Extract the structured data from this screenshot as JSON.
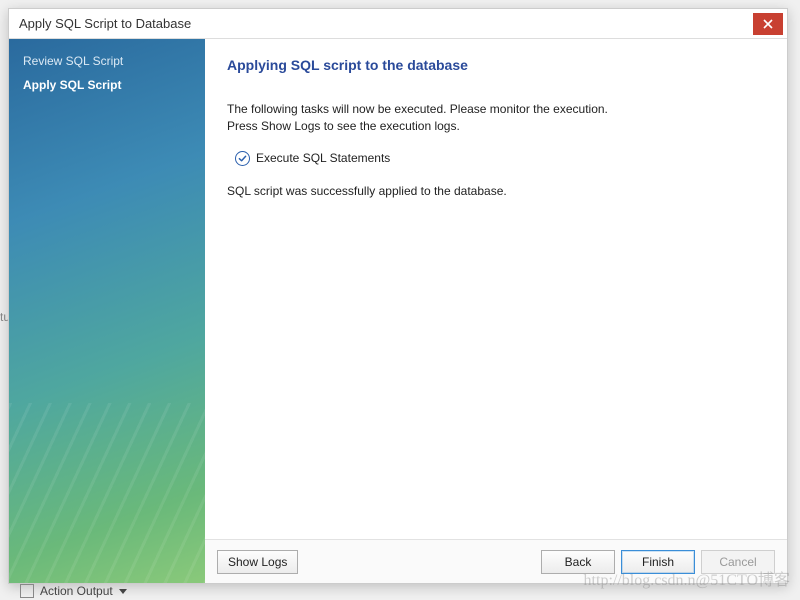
{
  "window": {
    "title": "Apply SQL Script to Database"
  },
  "sidebar": {
    "steps": [
      {
        "label": "Review SQL Script",
        "active": false
      },
      {
        "label": "Apply SQL Script",
        "active": true
      }
    ]
  },
  "main": {
    "heading": "Applying SQL script to the database",
    "instructions_line1": "The following tasks will now be executed. Please monitor the execution.",
    "instructions_line2": "Press Show Logs to see the execution logs.",
    "task": {
      "label": "Execute SQL Statements",
      "status": "done"
    },
    "success_message": "SQL script was successfully applied to the database."
  },
  "buttons": {
    "show_logs": "Show Logs",
    "back": "Back",
    "finish": "Finish",
    "cancel": "Cancel"
  },
  "watermark": "http://blog.csdn.n@51CTO博客",
  "background": {
    "action_output_label": "Action Output"
  }
}
